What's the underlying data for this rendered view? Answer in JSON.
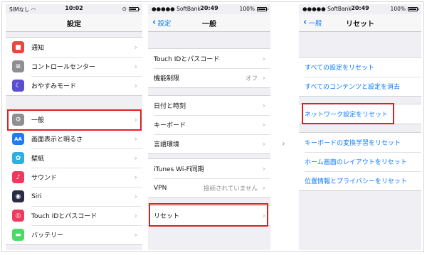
{
  "screen1": {
    "status": {
      "carrier": "SIMなし",
      "time": "10:02",
      "battery_level": 0.8
    },
    "nav": {
      "title": "設定"
    },
    "groups": [
      {
        "rows": [
          {
            "label": "通知",
            "icon": "notifications-icon",
            "color": "#e8473d",
            "glyph": "■"
          },
          {
            "label": "コントロールセンター",
            "icon": "control-center-icon",
            "color": "#8e8e93",
            "glyph": "≡"
          },
          {
            "label": "おやすみモード",
            "icon": "moon-icon",
            "color": "#5a4fcf",
            "glyph": "☾"
          }
        ]
      },
      {
        "rows": [
          {
            "label": "一般",
            "icon": "gear-icon",
            "color": "#8e8e93",
            "glyph": "⚙"
          },
          {
            "label": "画面表示と明るさ",
            "icon": "display-icon",
            "color": "#1f7bf2",
            "glyph": "AA"
          },
          {
            "label": "壁紙",
            "icon": "wallpaper-icon",
            "color": "#31aee0",
            "glyph": "✿"
          },
          {
            "label": "サウンド",
            "icon": "sound-icon",
            "color": "#ef3a5d",
            "glyph": "♪"
          },
          {
            "label": "Siri",
            "icon": "siri-icon",
            "color": "#2b2b45",
            "glyph": "◉"
          },
          {
            "label": "Touch IDとパスコード",
            "icon": "fingerprint-icon",
            "color": "#ef3a5d",
            "glyph": "◎"
          },
          {
            "label": "バッテリー",
            "icon": "battery-icon",
            "color": "#4cd964",
            "glyph": "▬"
          }
        ]
      }
    ]
  },
  "screen2": {
    "status": {
      "carrier": "●●●●● SoftBank",
      "time": "20:49",
      "battery": "100%"
    },
    "nav": {
      "back": "設定",
      "title": "一般"
    },
    "groups": [
      {
        "rows": [
          {
            "label": "Touch IDとパスコード",
            "value": ""
          },
          {
            "label": "機能制限",
            "value": "オフ"
          }
        ]
      },
      {
        "rows": [
          {
            "label": "日付と時刻",
            "value": ""
          },
          {
            "label": "キーボード",
            "value": ""
          },
          {
            "label": "言語環境",
            "value": ""
          }
        ]
      },
      {
        "rows": [
          {
            "label": "iTunes Wi-Fi同期",
            "value": ""
          },
          {
            "label": "VPN",
            "value": "接続されていません"
          }
        ]
      },
      {
        "rows": [
          {
            "label": "リセット",
            "value": ""
          }
        ]
      }
    ]
  },
  "screen3": {
    "status": {
      "carrier": "●●●●● SoftBank",
      "time": "20:49",
      "battery": "100%"
    },
    "nav": {
      "back": "一般",
      "title": "リセット"
    },
    "groups": [
      {
        "rows": [
          {
            "label": "すべての設定をリセット"
          },
          {
            "label": "すべてのコンテンツと設定を消去"
          }
        ]
      },
      {
        "rows": [
          {
            "label": "ネットワーク設定をリセット"
          }
        ]
      },
      {
        "rows": [
          {
            "label": "キーボードの変換学習をリセット"
          },
          {
            "label": "ホーム画面のレイアウトをリセット"
          },
          {
            "label": "位置情報とプライバシーをリセット"
          }
        ]
      }
    ]
  },
  "colors": {
    "accent": "#0a7aff",
    "highlight": "#e02020"
  }
}
